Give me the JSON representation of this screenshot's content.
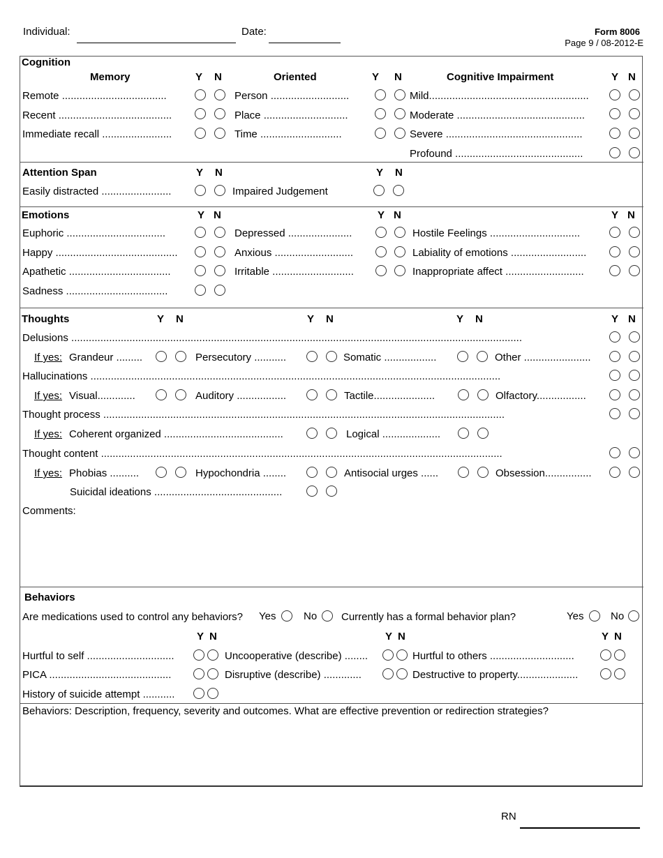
{
  "header": {
    "individual_label": "Individual:",
    "date_label": "Date:",
    "form_number": "Form 8006",
    "page_info": "Page 9 / 08-2012-E"
  },
  "yn": {
    "y": "Y",
    "n": "N",
    "yes": "Yes",
    "no": "No",
    "if_yes": "If yes:"
  },
  "cognition": {
    "title": "Cognition",
    "memory": {
      "heading": "Memory",
      "items": [
        "Remote ....................................",
        "Recent .......................................",
        "Immediate recall ........................"
      ]
    },
    "oriented": {
      "heading": "Oriented",
      "items": [
        "Person ...........................",
        "Place .............................",
        "Time  ............................"
      ]
    },
    "impairment": {
      "heading": "Cognitive Impairment",
      "items": [
        "Mild.......................................................",
        "Moderate ............................................",
        "Severe ...............................................",
        "Profound ............................................"
      ]
    }
  },
  "attention": {
    "title": "Attention Span",
    "items": [
      "Easily distracted ........................",
      "Impaired Judgement"
    ]
  },
  "emotions": {
    "title": "Emotions",
    "col1": [
      "Euphoric ..................................",
      "Happy ..........................................",
      "Apathetic ...................................",
      "Sadness  ..................................."
    ],
    "col2": [
      "Depressed ......................",
      "Anxious ...........................",
      "Irritable ............................"
    ],
    "col3": [
      "Hostile Feelings  ...............................",
      "Labiality of emotions ..........................",
      "Inappropriate affect ..........................."
    ]
  },
  "thoughts": {
    "title": "Thoughts",
    "delusions": "Delusions ...........................................................................................................................................................",
    "delusion_types": [
      "Grandeur .........",
      "Persecutory ...........",
      "Somatic ..................",
      "Other ......................."
    ],
    "hallucinations": "Hallucinations .............................................................................................................................................",
    "hallucination_types": [
      "Visual.............",
      "Auditory .................",
      "Tactile.....................",
      "Olfactory................."
    ],
    "process": "Thought process ..........................................................................................................................................",
    "process_types": [
      "Coherent organized .........................................",
      "Logical ...................."
    ],
    "content": "Thought content  ..........................................................................................................................................",
    "content_types": [
      "Phobias ..........",
      "Hypochondria ........",
      "Antisocial urges ......",
      "Obsession................"
    ],
    "suicidal": "Suicidal ideations ............................................",
    "comments_label": "Comments:"
  },
  "behaviors": {
    "title": "Behaviors",
    "medications_q": "Are medications used to control any behaviors?",
    "plan_q": "Currently has a formal behavior plan?",
    "col1": [
      "Hurtful to self ..............................",
      "PICA  ..........................................",
      "History of suicide attempt ..........."
    ],
    "col2": [
      "Uncooperative (describe) ........",
      "Disruptive (describe) ............."
    ],
    "col3": [
      "Hurtful to others .............................",
      "Destructive to property....................."
    ],
    "description_label": "Behaviors:  Description, frequency, severity and outcomes. What are effective prevention or redirection strategies?"
  },
  "footer": {
    "rn_label": "RN"
  }
}
